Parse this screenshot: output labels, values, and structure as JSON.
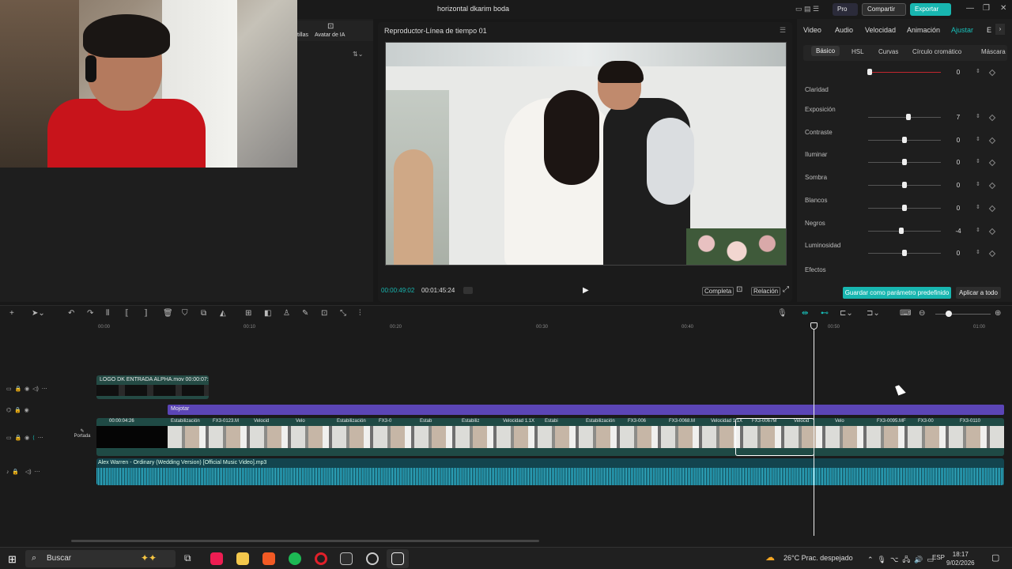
{
  "window": {
    "title": "horizontal dkarim boda",
    "pro": "Pro",
    "share": "Compartir",
    "export": "Exportar"
  },
  "media_panel": {
    "item1": "tillas",
    "item2": "Avatar de IA"
  },
  "player": {
    "title": "Reproductor-Línea de tiempo 01",
    "current_time": "00:00:49:02",
    "duration": "00:01:45:24",
    "complete": "Completa",
    "ratio": "Relación"
  },
  "adjust": {
    "tabs": [
      "Video",
      "Audio",
      "Velocidad",
      "Animación",
      "Ajustar",
      "E"
    ],
    "active_tab": "Ajustar",
    "subtabs": [
      "Básico",
      "HSL",
      "Curvas",
      "Círculo cromático",
      "Máscara"
    ],
    "top_value": "0",
    "section_clarity": "Claridad",
    "params": [
      {
        "label": "Exposición",
        "value": "7",
        "level": 0.55
      },
      {
        "label": "Contraste",
        "value": "0",
        "level": 0.5
      },
      {
        "label": "Iluminar",
        "value": "0",
        "level": 0.5
      },
      {
        "label": "Sombra",
        "value": "0",
        "level": 0.5
      },
      {
        "label": "Blancos",
        "value": "0",
        "level": 0.5
      },
      {
        "label": "Negros",
        "value": "-4",
        "level": 0.46
      },
      {
        "label": "Luminosidad",
        "value": "0",
        "level": 0.5
      }
    ],
    "effects": "Efectos",
    "save_preset": "Guardar como parámetro predefinido",
    "apply_all": "Aplicar a todo"
  },
  "timeline": {
    "ruler": [
      "00:00",
      "00:10",
      "00:20",
      "00:30",
      "00:40",
      "00:50",
      "01:00"
    ],
    "overlay_clip": "LOGO DK ENTRADA ALPHA.mov  00:00:07:",
    "effect": "Mojotar",
    "main_time": "00:00:04:26",
    "clip_labels": [
      "Estabilización",
      "FX3-0123.M",
      "Velocid",
      "Velo",
      "Estabilización",
      "FX3-0",
      "Estab",
      "Estabiliz",
      "Velocidad 1.1X",
      "Estabi",
      "Estabilización",
      "FX3-006",
      "FX3-0068.M",
      "Velocidad 1.1X",
      "FX3-0067M",
      "Velocid",
      "Velo",
      "FX3-0095.MF",
      "FX3-00",
      "FX3-0110"
    ],
    "portada": "Portada",
    "audio": "Alex Warren - Ordinary (Wedding Version) [Official Music Video].mp3"
  },
  "taskbar": {
    "search": "Buscar",
    "weather": "26°C  Prac. despejado",
    "lang": "ESP",
    "time": "18:17",
    "date": "9/02/2026"
  }
}
